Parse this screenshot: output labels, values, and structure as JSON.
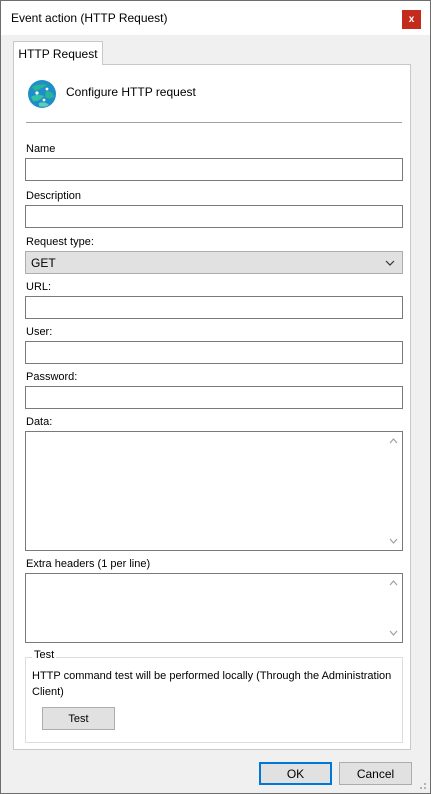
{
  "window": {
    "title": "Event action (HTTP Request)",
    "close_glyph": "x"
  },
  "tab": {
    "label": "HTTP Request"
  },
  "header": {
    "title": "Configure HTTP request",
    "icon": "globe-network-icon"
  },
  "form": {
    "name": {
      "label": "Name",
      "value": ""
    },
    "description": {
      "label": "Description",
      "value": ""
    },
    "request_type": {
      "label": "Request type:",
      "selected": "GET"
    },
    "url": {
      "label": "URL:",
      "value": ""
    },
    "user": {
      "label": "User:",
      "value": ""
    },
    "password": {
      "label": "Password:",
      "value": ""
    },
    "data": {
      "label": "Data:",
      "value": ""
    },
    "extra_headers": {
      "label": "Extra headers (1 per line)",
      "value": ""
    }
  },
  "test_group": {
    "title": "Test",
    "description": "HTTP command test will be performed locally (Through the Administration Client)",
    "button_label": "Test"
  },
  "footer": {
    "ok_label": "OK",
    "cancel_label": "Cancel"
  },
  "colors": {
    "close": "#c42b1c",
    "focus": "#0078d7",
    "icon_primary": "#1e8fc6",
    "icon_secondary": "#2bb39a"
  }
}
